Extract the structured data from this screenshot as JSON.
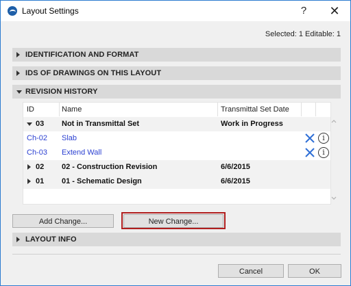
{
  "window": {
    "title": "Layout Settings",
    "help_label": "?",
    "close_label": "✕"
  },
  "selected_info": "Selected: 1 Editable: 1",
  "sections": {
    "identification": "IDENTIFICATION AND FORMAT",
    "ids_of_drawings": "IDS OF DRAWINGS ON THIS LAYOUT",
    "revision_history": "REVISION HISTORY",
    "layout_info": "LAYOUT INFO"
  },
  "table": {
    "headers": [
      "ID",
      "Name",
      "Transmittal Set Date"
    ],
    "rows": [
      {
        "id": "03",
        "name": "Not in Transmittal Set",
        "date": "Work in Progress"
      },
      {
        "id": "Ch-02",
        "name": "Slab"
      },
      {
        "id": "Ch-03",
        "name": "Extend Wall"
      },
      {
        "id": "02",
        "name": "02 - Construction Revision",
        "date": "6/6/2015"
      },
      {
        "id": "01",
        "name": "01 - Schematic Design",
        "date": "6/6/2015"
      }
    ]
  },
  "buttons": {
    "add_change": "Add Change...",
    "new_change": "New Change...",
    "cancel": "Cancel",
    "ok": "OK"
  },
  "colors": {
    "accent_border": "#2b7bd0",
    "highlight": "#b01e1e",
    "link": "#2a3fd1",
    "delete_icon": "#2f6fd6"
  }
}
